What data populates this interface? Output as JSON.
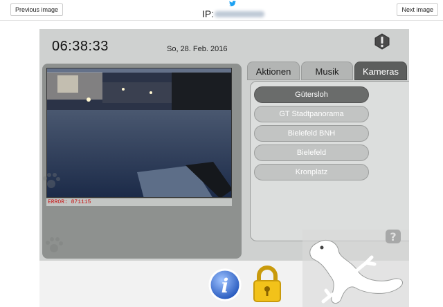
{
  "page": {
    "prev_button": "Previous image",
    "next_button": "Next image",
    "ip_label": "IP:"
  },
  "device": {
    "time": "06:38:33",
    "date": "So, 28. Feb. 2016",
    "tabs": [
      {
        "label": "Aktionen",
        "active": false
      },
      {
        "label": "Musik",
        "active": false
      },
      {
        "label": "Kameras",
        "active": true
      }
    ],
    "cameras": [
      {
        "label": "Gütersloh",
        "active": true
      },
      {
        "label": "GT Stadtpanorama",
        "active": false
      },
      {
        "label": "Bielefeld BNH",
        "active": false
      },
      {
        "label": "Bielefeld",
        "active": false
      },
      {
        "label": "Kronplatz",
        "active": false
      }
    ],
    "camera_status": "ERROR: 871115",
    "icons": {
      "alert": "exclamation-icon",
      "help": "question-icon",
      "info": "info-icon",
      "lock": "padlock-icon",
      "logo": "gecko-icon"
    }
  }
}
